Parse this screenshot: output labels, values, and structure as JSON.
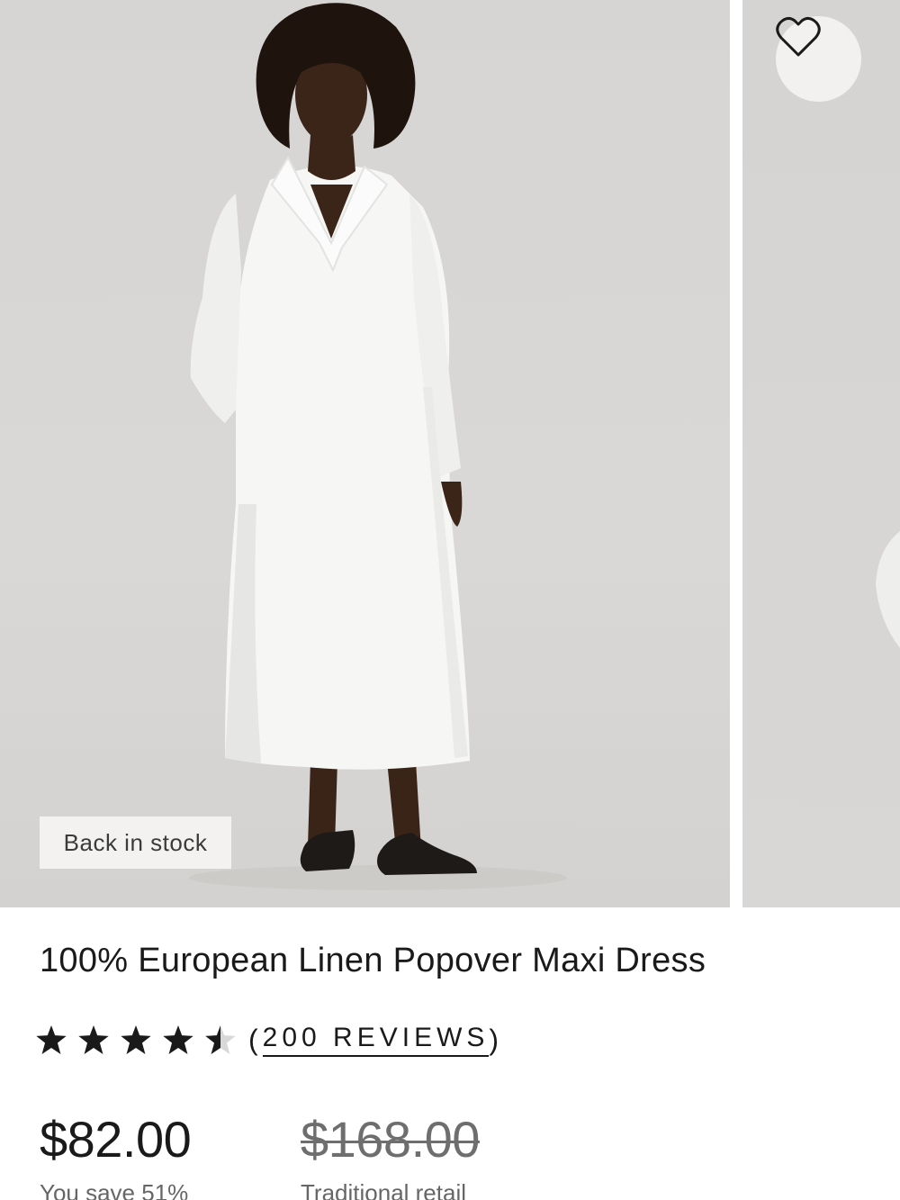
{
  "gallery": {
    "badge": "Back in stock",
    "favorite_icon": "heart-outline-icon"
  },
  "product": {
    "title": "100% European Linen Popover Maxi Dress",
    "rating": {
      "stars": 4.5,
      "max_stars": 5,
      "reviews_open": "(",
      "reviews_label": "200 REVIEWS",
      "reviews_close": ")"
    },
    "price": {
      "sale": "$82.00",
      "savings": "You save 51%",
      "retail": "$168.00",
      "retail_label": "Traditional retail"
    }
  },
  "colors": {
    "text": "#1a1a1a",
    "muted": "#6e6e6e",
    "image_bg": "#d8d6d4",
    "badge_bg": "#f3f2f1"
  }
}
